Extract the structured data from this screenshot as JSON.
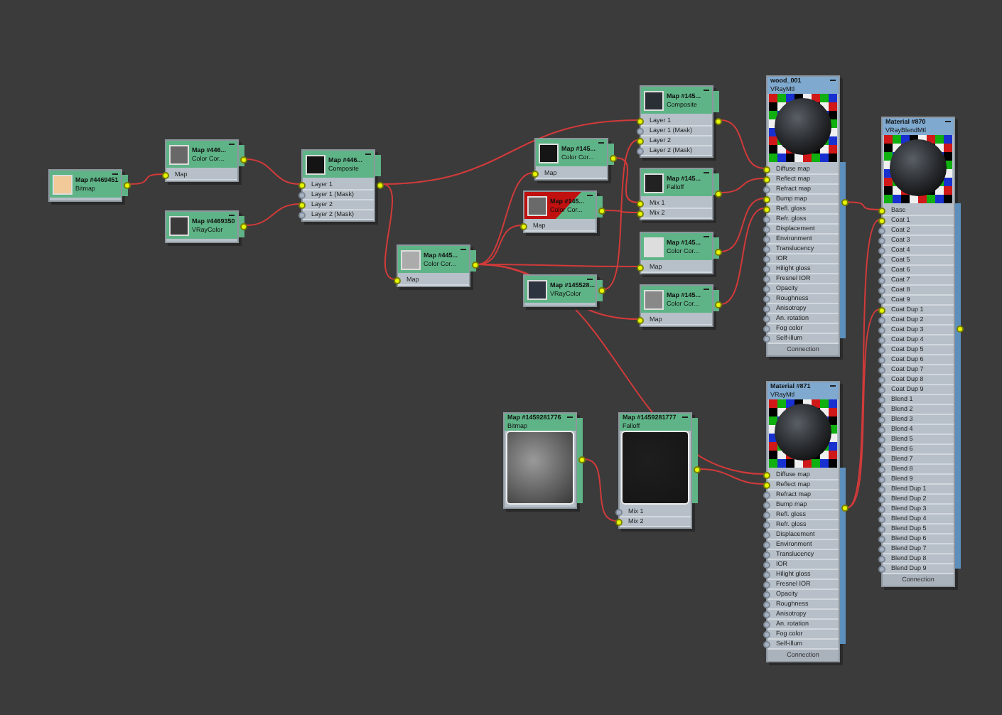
{
  "nodes": [
    {
      "kind": "map",
      "title": "Map #4469451",
      "subtitle": "Bitmap",
      "flagged": false,
      "preview": {
        "kind": "swatch",
        "color": "#f2c999"
      }
    },
    {
      "kind": "map",
      "title": "Map #446...",
      "subtitle": "Color Cor...",
      "flagged": false,
      "preview": {
        "kind": "swatch",
        "color": "#686868"
      },
      "slots": [
        {
          "label": "Map",
          "connected": true
        }
      ]
    },
    {
      "kind": "map",
      "title": "Map #4469350",
      "subtitle": "VRayColor",
      "flagged": false,
      "preview": {
        "kind": "swatch",
        "color": "#3a3a3a"
      }
    },
    {
      "kind": "map",
      "title": "Map #446...",
      "subtitle": "Composite",
      "flagged": false,
      "preview": {
        "kind": "swatch",
        "color": "#141414"
      },
      "slots": [
        {
          "label": "Layer 1",
          "connected": true
        },
        {
          "label": "Layer 1 (Mask)",
          "connected": false
        },
        {
          "label": "Layer 2",
          "connected": true
        },
        {
          "label": "Layer 2 (Mask)",
          "connected": false
        }
      ]
    },
    {
      "kind": "map",
      "title": "Map #445...",
      "subtitle": "Color Cor...",
      "flagged": false,
      "preview": {
        "kind": "swatch",
        "color": "#ababab"
      },
      "slots": [
        {
          "label": "Map",
          "connected": true
        }
      ]
    },
    {
      "kind": "map",
      "title": "Map #145...",
      "subtitle": "Color Cor...",
      "flagged": false,
      "preview": {
        "kind": "swatch",
        "color": "#151515"
      },
      "slots": [
        {
          "label": "Map",
          "connected": true
        }
      ]
    },
    {
      "kind": "map",
      "title": "Map #145...",
      "subtitle": "Color Cor...",
      "flagged": true,
      "preview": {
        "kind": "swatch",
        "color": "#6a6a6a"
      },
      "slots": [
        {
          "label": "Map",
          "connected": true
        }
      ]
    },
    {
      "kind": "map",
      "title": "Map #145528...",
      "subtitle": "VRayColor",
      "flagged": false,
      "preview": {
        "kind": "swatch",
        "color": "#2e3440"
      }
    },
    {
      "kind": "map",
      "title": "Map #145...",
      "subtitle": "Composite",
      "flagged": false,
      "preview": {
        "kind": "swatch",
        "color": "#2a2e35"
      },
      "slots": [
        {
          "label": "Layer 1",
          "connected": true
        },
        {
          "label": "Layer 1 (Mask)",
          "connected": false
        },
        {
          "label": "Layer 2",
          "connected": true
        },
        {
          "label": "Layer 2 (Mask)",
          "connected": false
        }
      ]
    },
    {
      "kind": "map",
      "title": "Map #145...",
      "subtitle": "Falloff",
      "flagged": false,
      "preview": {
        "kind": "swatch",
        "color": "#222222"
      },
      "slots": [
        {
          "label": "Mix 1",
          "connected": true
        },
        {
          "label": "Mix 2",
          "connected": true
        }
      ]
    },
    {
      "kind": "map",
      "title": "Map #145...",
      "subtitle": "Color Cor...",
      "flagged": false,
      "preview": {
        "kind": "swatch",
        "color": "#dddddd"
      },
      "slots": [
        {
          "label": "Map",
          "connected": true
        }
      ]
    },
    {
      "kind": "map",
      "title": "Map #145...",
      "subtitle": "Color Cor...",
      "flagged": false,
      "preview": {
        "kind": "swatch",
        "color": "#888888"
      },
      "slots": [
        {
          "label": "Map",
          "connected": true
        }
      ]
    },
    {
      "kind": "material",
      "title": "wood_001",
      "subtitle": "VRayMtl",
      "flagged": false,
      "preview": {
        "kind": "sphere"
      },
      "footer": "Connection",
      "slots": [
        {
          "label": "Diffuse map",
          "connected": true
        },
        {
          "label": "Reflect map",
          "connected": true
        },
        {
          "label": "Refract map",
          "connected": false
        },
        {
          "label": "Bump map",
          "connected": true
        },
        {
          "label": "Refl. gloss",
          "connected": true
        },
        {
          "label": "Refr. gloss",
          "connected": false
        },
        {
          "label": "Displacement",
          "connected": false
        },
        {
          "label": "Environment",
          "connected": false
        },
        {
          "label": "Translucency",
          "connected": false
        },
        {
          "label": "IOR",
          "connected": false
        },
        {
          "label": "Hilight gloss",
          "connected": false
        },
        {
          "label": "Fresnel IOR",
          "connected": false
        },
        {
          "label": "Opacity",
          "connected": false
        },
        {
          "label": "Roughness",
          "connected": false
        },
        {
          "label": "Anisotropy",
          "connected": false
        },
        {
          "label": "An. rotation",
          "connected": false
        },
        {
          "label": "Fog color",
          "connected": false
        },
        {
          "label": "Self-illum",
          "connected": false
        }
      ]
    },
    {
      "kind": "material",
      "title": "Material #870",
      "subtitle": "VRayBlendMtl",
      "flagged": false,
      "preview": {
        "kind": "sphere"
      },
      "footer": "Connection",
      "slots": [
        {
          "label": "Base",
          "connected": true
        },
        {
          "label": "Coat 1",
          "connected": true
        },
        {
          "label": "Coat 2",
          "connected": false
        },
        {
          "label": "Coat 3",
          "connected": false
        },
        {
          "label": "Coat 4",
          "connected": false
        },
        {
          "label": "Coat 5",
          "connected": false
        },
        {
          "label": "Coat 6",
          "connected": false
        },
        {
          "label": "Coat 7",
          "connected": false
        },
        {
          "label": "Coat 8",
          "connected": false
        },
        {
          "label": "Coat 9",
          "connected": false
        },
        {
          "label": "Coat Dup 1",
          "connected": true
        },
        {
          "label": "Coat Dup 2",
          "connected": false
        },
        {
          "label": "Coat Dup 3",
          "connected": false
        },
        {
          "label": "Coat Dup 4",
          "connected": false
        },
        {
          "label": "Coat Dup 5",
          "connected": false
        },
        {
          "label": "Coat Dup 6",
          "connected": false
        },
        {
          "label": "Coat Dup 7",
          "connected": false
        },
        {
          "label": "Coat Dup 8",
          "connected": false
        },
        {
          "label": "Coat Dup 9",
          "connected": false
        },
        {
          "label": "Blend 1",
          "connected": false
        },
        {
          "label": "Blend 2",
          "connected": false
        },
        {
          "label": "Blend 3",
          "connected": false
        },
        {
          "label": "Blend 4",
          "connected": false
        },
        {
          "label": "Blend 5",
          "connected": false
        },
        {
          "label": "Blend 6",
          "connected": false
        },
        {
          "label": "Blend 7",
          "connected": false
        },
        {
          "label": "Blend 8",
          "connected": false
        },
        {
          "label": "Blend 9",
          "connected": false
        },
        {
          "label": "Blend Dup 1",
          "connected": false
        },
        {
          "label": "Blend Dup 2",
          "connected": false
        },
        {
          "label": "Blend Dup 3",
          "connected": false
        },
        {
          "label": "Blend Dup 4",
          "connected": false
        },
        {
          "label": "Blend Dup 5",
          "connected": false
        },
        {
          "label": "Blend Dup 6",
          "connected": false
        },
        {
          "label": "Blend Dup 7",
          "connected": false
        },
        {
          "label": "Blend Dup 8",
          "connected": false
        },
        {
          "label": "Blend Dup 9",
          "connected": false
        }
      ]
    },
    {
      "kind": "map",
      "title": "Map #1459281776",
      "subtitle": "Bitmap",
      "flagged": false,
      "preview": {
        "kind": "texture",
        "color": "#9a9a9a"
      }
    },
    {
      "kind": "map",
      "title": "Map #1459281777",
      "subtitle": "Falloff",
      "flagged": false,
      "preview": {
        "kind": "texture",
        "color": "#1e1e1e"
      },
      "slots": [
        {
          "label": "Mix 1",
          "connected": false
        },
        {
          "label": "Mix 2",
          "connected": true
        }
      ]
    },
    {
      "kind": "material",
      "title": "Material #871",
      "subtitle": "VRayMtl",
      "flagged": false,
      "preview": {
        "kind": "sphere"
      },
      "footer": "Connection",
      "slots": [
        {
          "label": "Diffuse map",
          "connected": true
        },
        {
          "label": "Reflect map",
          "connected": true
        },
        {
          "label": "Refract map",
          "connected": false
        },
        {
          "label": "Bump map",
          "connected": false
        },
        {
          "label": "Refl. gloss",
          "connected": false
        },
        {
          "label": "Refr. gloss",
          "connected": false
        },
        {
          "label": "Displacement",
          "connected": false
        },
        {
          "label": "Environment",
          "connected": false
        },
        {
          "label": "Translucency",
          "connected": false
        },
        {
          "label": "IOR",
          "connected": false
        },
        {
          "label": "Hilight gloss",
          "connected": false
        },
        {
          "label": "Fresnel IOR",
          "connected": false
        },
        {
          "label": "Opacity",
          "connected": false
        },
        {
          "label": "Roughness",
          "connected": false
        },
        {
          "label": "Anisotropy",
          "connected": false
        },
        {
          "label": "An. rotation",
          "connected": false
        },
        {
          "label": "Fog color",
          "connected": false
        },
        {
          "label": "Self-illum",
          "connected": false
        }
      ]
    }
  ]
}
